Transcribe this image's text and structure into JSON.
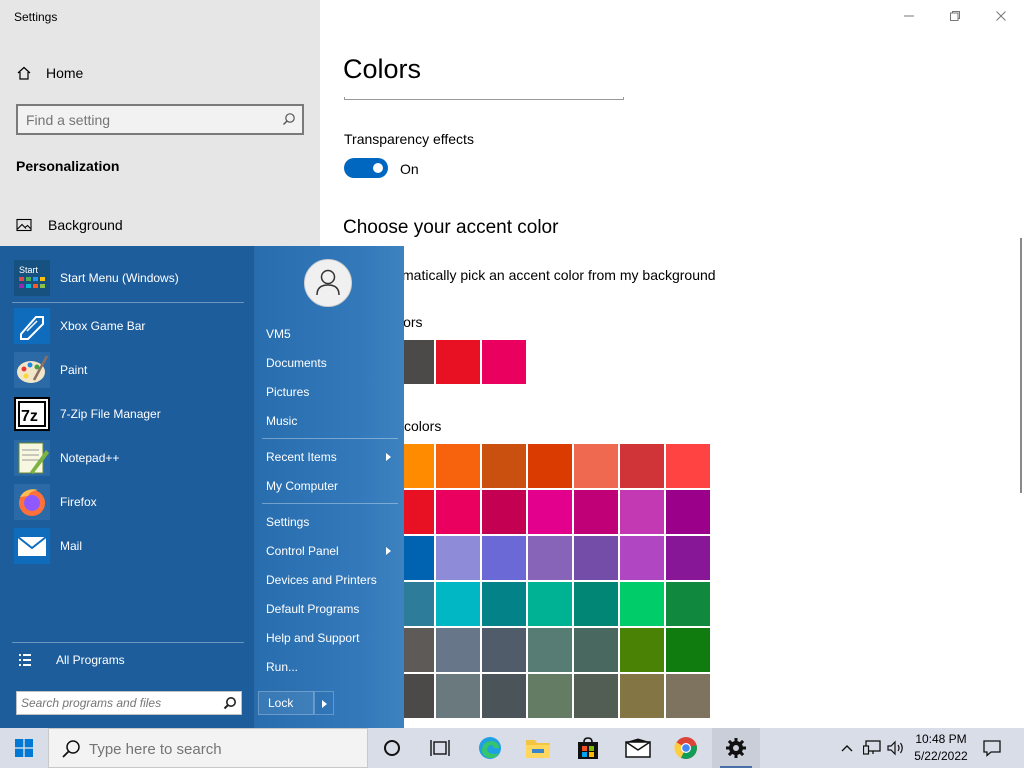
{
  "sidebar": {
    "app_title": "Settings",
    "home_label": "Home",
    "search_placeholder": "Find a setting",
    "section_title": "Personalization",
    "items": [
      {
        "label": "Background"
      }
    ]
  },
  "main": {
    "page_title": "Colors",
    "transparency_label": "Transparency effects",
    "transparency_state": "On",
    "accent_heading": "Choose your accent color",
    "auto_pick_label": "matically pick an accent color from my background",
    "recent_colors_label": "lors",
    "windows_colors_label": "colors",
    "recent_colors": [
      "#4c4a48",
      "#e81123",
      "#ea005e"
    ],
    "windows_colors": [
      [
        "#ff8c00",
        "#f7630c",
        "#ca5010",
        "#da3b01",
        "#ef6950",
        "#d13438",
        "#ff4343"
      ],
      [
        "#e81123",
        "#ea005e",
        "#c30052",
        "#e3008c",
        "#bf0077",
        "#c239b3",
        "#9a0089"
      ],
      [
        "#0063b1",
        "#8e8cd8",
        "#6b69d6",
        "#8764b8",
        "#744da9",
        "#b146c2",
        "#881798"
      ],
      [
        "#2d7d9a",
        "#00b7c3",
        "#038387",
        "#00b294",
        "#018574",
        "#00cc6a",
        "#10893e"
      ],
      [
        "#5d5a58",
        "#68768a",
        "#515c6b",
        "#567c73",
        "#486860",
        "#498205",
        "#107c10"
      ],
      [
        "#4c4a48",
        "#69797e",
        "#4a5459",
        "#647c64",
        "#525e54",
        "#847545",
        "#7e735f"
      ]
    ]
  },
  "start_menu": {
    "pinned": [
      {
        "label": "Start Menu (Windows)",
        "icon": "start-menu-app-icon"
      },
      {
        "label": "Xbox Game Bar",
        "icon": "xbox-game-bar-icon"
      },
      {
        "label": "Paint",
        "icon": "paint-icon"
      },
      {
        "label": "7-Zip File Manager",
        "icon": "seven-zip-icon"
      },
      {
        "label": "Notepad++",
        "icon": "notepad-plus-plus-icon"
      },
      {
        "label": "Firefox",
        "icon": "firefox-icon"
      },
      {
        "label": "Mail",
        "icon": "mail-icon"
      }
    ],
    "start_icon_text": "Start",
    "seven_zip_text": "7z",
    "all_programs": "All Programs",
    "search_placeholder": "Search programs and files",
    "right_links": [
      "VM5",
      "Documents",
      "Pictures",
      "Music",
      "Recent Items",
      "My Computer",
      "Settings",
      "Control Panel",
      "Devices and Printers",
      "Default Programs",
      "Help and Support",
      "Run..."
    ],
    "lock_label": "Lock"
  },
  "taskbar": {
    "search_placeholder": "Type here to search",
    "time": "10:48 PM",
    "date": "5/22/2022"
  },
  "colors": {
    "accent": "#0067c0",
    "start_menu_bg": "#1e5d9c",
    "taskbar_bg": "#d9dde8"
  }
}
